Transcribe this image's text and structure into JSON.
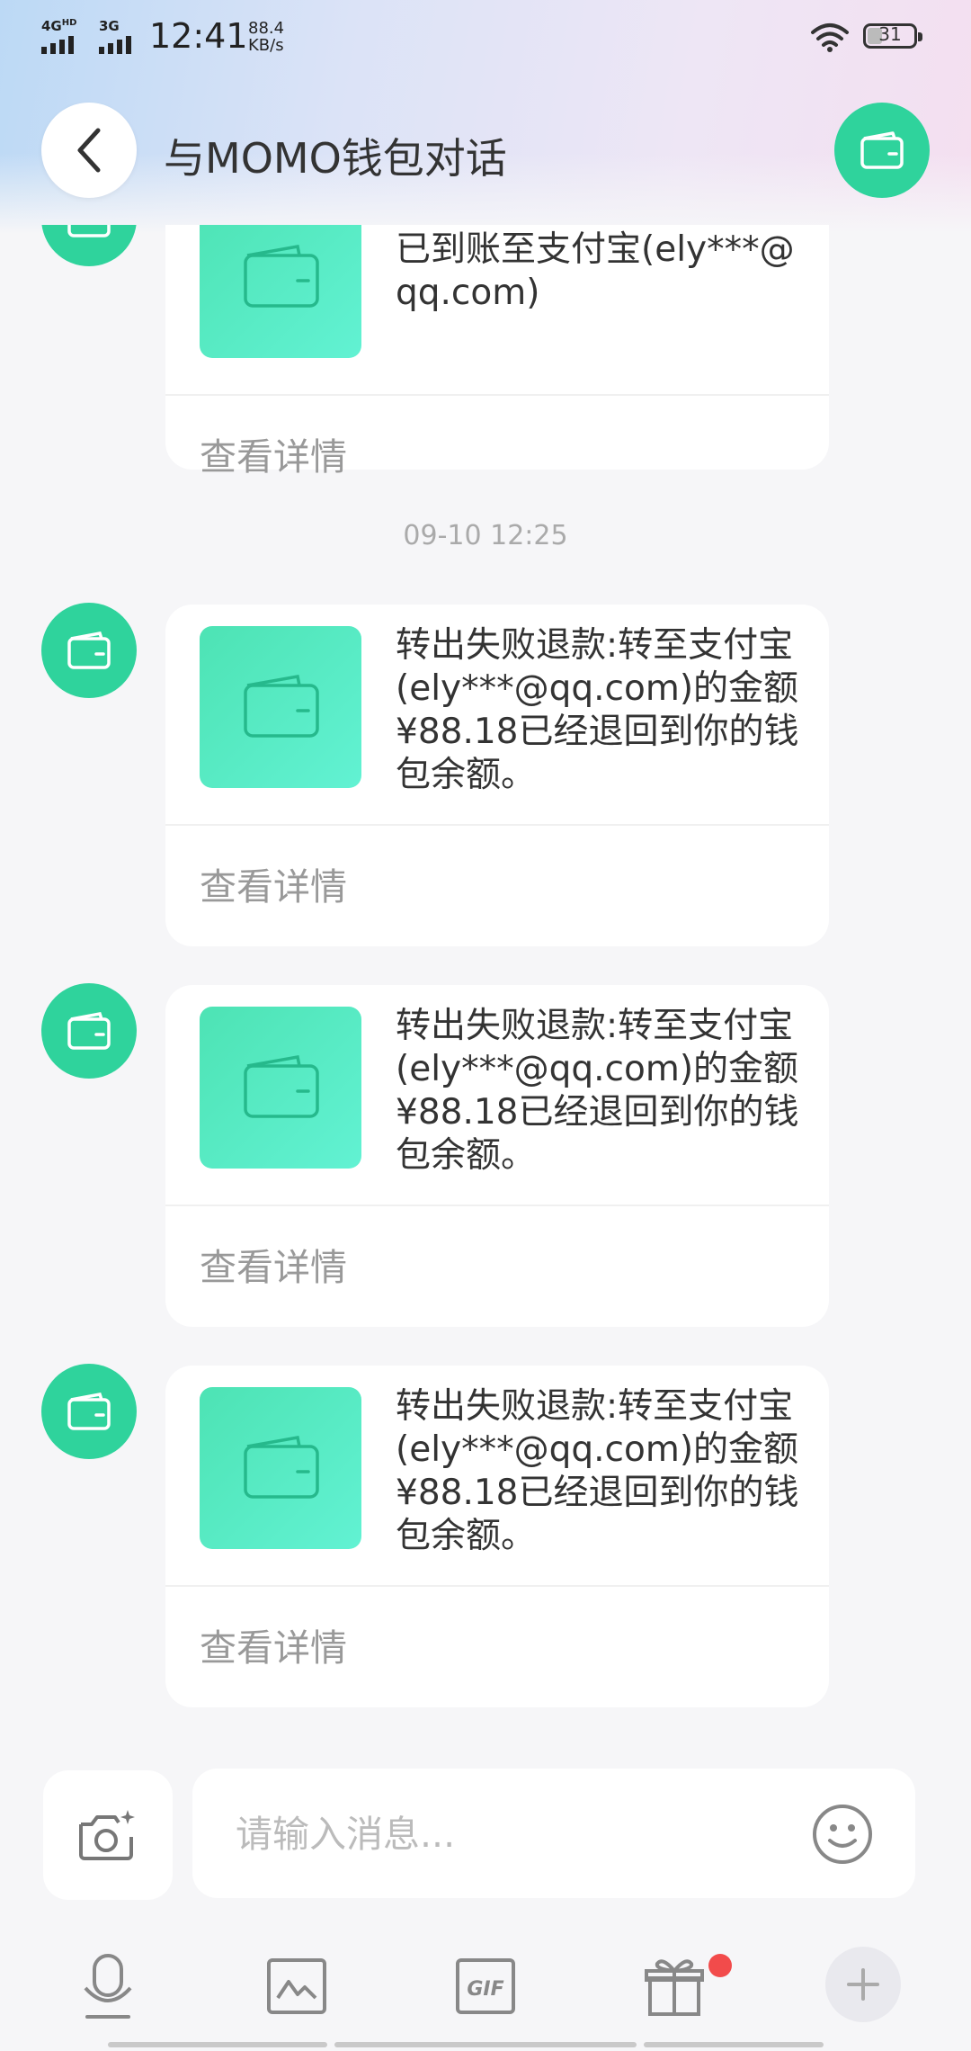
{
  "status_bar": {
    "net1": "4G",
    "net1_sup": "HD",
    "net2": "3G",
    "time": "12:41",
    "speed_value": "88.4",
    "speed_unit": "KB/s",
    "battery": "31"
  },
  "header": {
    "title": "与MOMO钱包对话"
  },
  "messages": [
    {
      "text": "已到账至支付宝(ely***@qq.com)",
      "detail": "查看详情"
    },
    {
      "text": "转出失败退款:转至支付宝(ely***@qq.com)的金额¥88.18已经退回到你的钱包余额。",
      "detail": "查看详情"
    },
    {
      "text": "转出失败退款:转至支付宝(ely***@qq.com)的金额¥88.18已经退回到你的钱包余额。",
      "detail": "查看详情"
    },
    {
      "text": "转出失败退款:转至支付宝(ely***@qq.com)的金额¥88.18已经退回到你的钱包余额。",
      "detail": "查看详情"
    }
  ],
  "time_separator": "09-10 12:25",
  "input": {
    "placeholder": "请输入消息..."
  },
  "toolbar": {
    "gif_label": "GIF",
    "icons": [
      "microphone-icon",
      "picture-icon",
      "gif-icon",
      "gift-icon",
      "plus-icon"
    ]
  },
  "colors": {
    "accent": "#2fd39c",
    "thumb_gradient_start": "#4de3b4",
    "thumb_gradient_end": "#62f2d3",
    "badge": "#f24b4b"
  }
}
